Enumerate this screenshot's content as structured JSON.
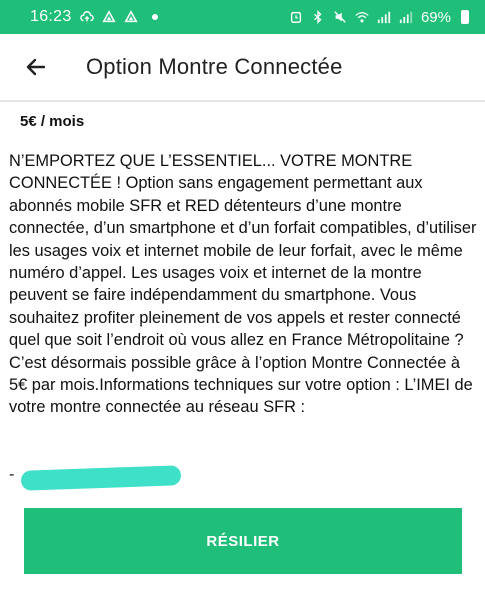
{
  "status_bar": {
    "time": "16:23",
    "battery_text": "69%",
    "icons": [
      "cloud-upload-icon",
      "triangle-app-icon",
      "triangle-app-icon",
      "dot-icon",
      "alarm-icon",
      "bluetooth-icon",
      "mute-icon",
      "wifi-icon",
      "signal-icon",
      "signal-icon",
      "battery-icon"
    ]
  },
  "header": {
    "title": "Option Montre Connectée",
    "back_icon": "arrow-left-icon"
  },
  "price": "5€ / mois",
  "description": "N’EMPORTEZ QUE L’ESSENTIEL... VOTRE MONTRE CONNECTÉE ! Option sans engagement permettant aux abonnés mobile SFR et RED détenteurs d’une montre connectée, d’un smartphone et d’un forfait compatibles, d’utiliser les usages voix et internet mobile de leur forfait, avec le même numéro d’appel. Les usages voix et internet de la montre peuvent se faire indépendamment du smartphone. Vous souhaitez profiter pleinement de vos appels et rester connecté quel que soit l’endroit où vous allez en France Métropolitaine ? C’est désormais possible grâce à l’option Montre Connectée à 5€ par mois.Informations techniques sur votre option : L’IMEI de votre montre connectée au réseau SFR :",
  "imei_value": "-",
  "cta_label": "RÉSILIER",
  "colors": {
    "accent": "#1fbf7a",
    "redaction": "#3ee0c8"
  }
}
